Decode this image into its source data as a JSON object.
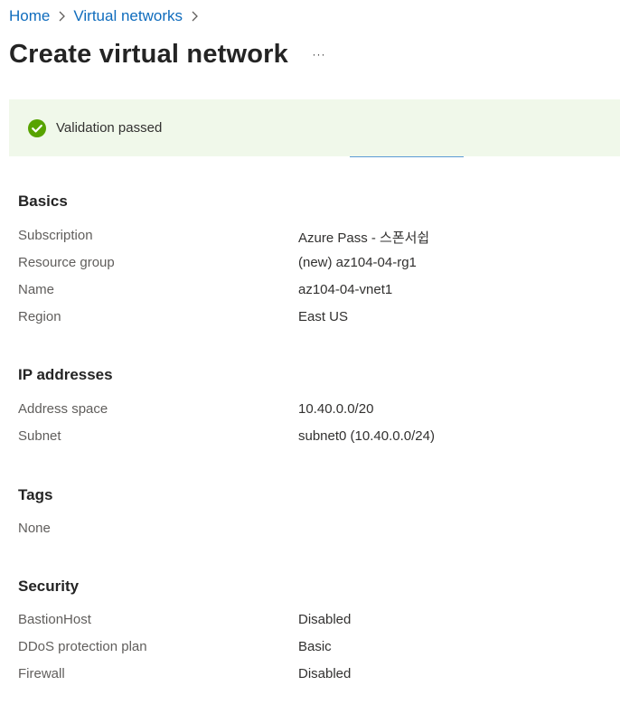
{
  "breadcrumb": {
    "items": [
      "Home",
      "Virtual networks"
    ]
  },
  "page": {
    "title": "Create virtual network",
    "more_label": "···"
  },
  "validation": {
    "text": "Validation passed",
    "status_color": "#57a300"
  },
  "sections": {
    "basics": {
      "title": "Basics",
      "rows": [
        {
          "label": "Subscription",
          "value": "Azure Pass - 스폰서쉽"
        },
        {
          "label": "Resource group",
          "value": "(new) az104-04-rg1"
        },
        {
          "label": "Name",
          "value": "az104-04-vnet1"
        },
        {
          "label": "Region",
          "value": "East US"
        }
      ]
    },
    "ip": {
      "title": "IP addresses",
      "rows": [
        {
          "label": "Address space",
          "value": "10.40.0.0/20"
        },
        {
          "label": "Subnet",
          "value": "subnet0 (10.40.0.0/24)"
        }
      ]
    },
    "tags": {
      "title": "Tags",
      "rows": [
        {
          "label": "None"
        }
      ]
    },
    "security": {
      "title": "Security",
      "rows": [
        {
          "label": "BastionHost",
          "value": "Disabled"
        },
        {
          "label": "DDoS protection plan",
          "value": "Basic"
        },
        {
          "label": "Firewall",
          "value": "Disabled"
        }
      ]
    }
  }
}
